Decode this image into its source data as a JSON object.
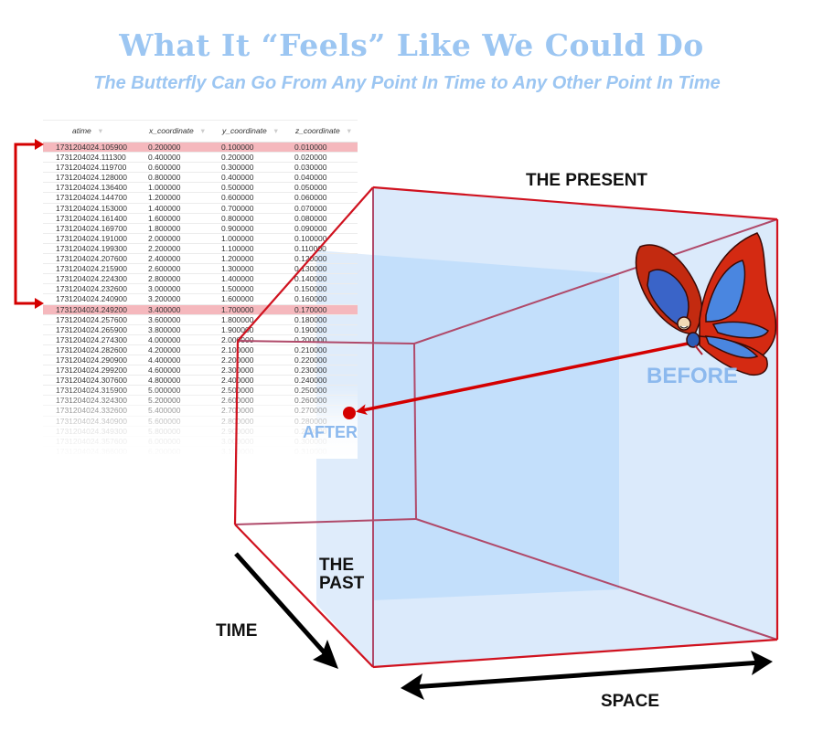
{
  "header": {
    "title": "What It “Feels” Like We Could Do",
    "subtitle": "The Butterfly Can Go From Any Point In Time to Any Other Point In Time"
  },
  "table": {
    "columns": [
      "atime",
      "x_coordinate",
      "y_coordinate",
      "z_coordinate"
    ],
    "highlighted_rows": [
      0,
      18
    ],
    "rows": [
      [
        "1731204024.105900",
        "0.200000",
        "0.100000",
        "0.010000"
      ],
      [
        "1731204024.111300",
        "0.400000",
        "0.200000",
        "0.020000"
      ],
      [
        "1731204024.119700",
        "0.600000",
        "0.300000",
        "0.030000"
      ],
      [
        "1731204024.128000",
        "0.800000",
        "0.400000",
        "0.040000"
      ],
      [
        "1731204024.136400",
        "1.000000",
        "0.500000",
        "0.050000"
      ],
      [
        "1731204024.144700",
        "1.200000",
        "0.600000",
        "0.060000"
      ],
      [
        "1731204024.153000",
        "1.400000",
        "0.700000",
        "0.070000"
      ],
      [
        "1731204024.161400",
        "1.600000",
        "0.800000",
        "0.080000"
      ],
      [
        "1731204024.169700",
        "1.800000",
        "0.900000",
        "0.090000"
      ],
      [
        "1731204024.191000",
        "2.000000",
        "1.000000",
        "0.100000"
      ],
      [
        "1731204024.199300",
        "2.200000",
        "1.100000",
        "0.110000"
      ],
      [
        "1731204024.207600",
        "2.400000",
        "1.200000",
        "0.120000"
      ],
      [
        "1731204024.215900",
        "2.600000",
        "1.300000",
        "0.130000"
      ],
      [
        "1731204024.224300",
        "2.800000",
        "1.400000",
        "0.140000"
      ],
      [
        "1731204024.232600",
        "3.000000",
        "1.500000",
        "0.150000"
      ],
      [
        "1731204024.240900",
        "3.200000",
        "1.600000",
        "0.160000"
      ],
      [
        "1731204024.249200",
        "3.400000",
        "1.700000",
        "0.170000"
      ],
      [
        "1731204024.257600",
        "3.600000",
        "1.800000",
        "0.180000"
      ],
      [
        "1731204024.265900",
        "3.800000",
        "1.900000",
        "0.190000"
      ],
      [
        "1731204024.274300",
        "4.000000",
        "2.000000",
        "0.200000"
      ],
      [
        "1731204024.282600",
        "4.200000",
        "2.100000",
        "0.210000"
      ],
      [
        "1731204024.290900",
        "4.400000",
        "2.200000",
        "0.220000"
      ],
      [
        "1731204024.299200",
        "4.600000",
        "2.300000",
        "0.230000"
      ],
      [
        "1731204024.307600",
        "4.800000",
        "2.400000",
        "0.240000"
      ],
      [
        "1731204024.315900",
        "5.000000",
        "2.500000",
        "0.250000"
      ],
      [
        "1731204024.324300",
        "5.200000",
        "2.600000",
        "0.260000"
      ],
      [
        "1731204024.332600",
        "5.400000",
        "2.700000",
        "0.270000"
      ],
      [
        "1731204024.340900",
        "5.600000",
        "2.800000",
        "0.280000"
      ],
      [
        "1731204024.349300",
        "5.800000",
        "2.900000",
        "0.290000"
      ],
      [
        "1731204024.357600",
        "6.000000",
        "3.000000",
        "0.300000"
      ],
      [
        "1731204024.366000",
        "6.200000",
        "3.100000",
        "0.310000"
      ]
    ]
  },
  "diagram": {
    "labels": {
      "present": "THE PRESENT",
      "past_line1": "THE",
      "past_line2": "PAST",
      "time": "TIME",
      "space": "SPACE",
      "before": "BEFORE",
      "after": "AFTER"
    },
    "icons": {
      "butterfly": "butterfly-hero-icon",
      "time_arrow": "arrow-down-right-icon",
      "space_arrow": "double-arrow-horizontal-icon",
      "row_link_arrow": "bracket-arrow-icon"
    },
    "colors": {
      "title_blue": "#9cc6f2",
      "cube_edge": "#d0121f",
      "cube_back_edge": "#b04a6a",
      "cube_fill": "#dbeafb",
      "slice_fill": "#c3dffb",
      "highlight_row": "#f5b8bd",
      "arrow_red": "#d40000",
      "wing_red": "#d42a12",
      "wing_blue": "#4a86e0"
    }
  }
}
